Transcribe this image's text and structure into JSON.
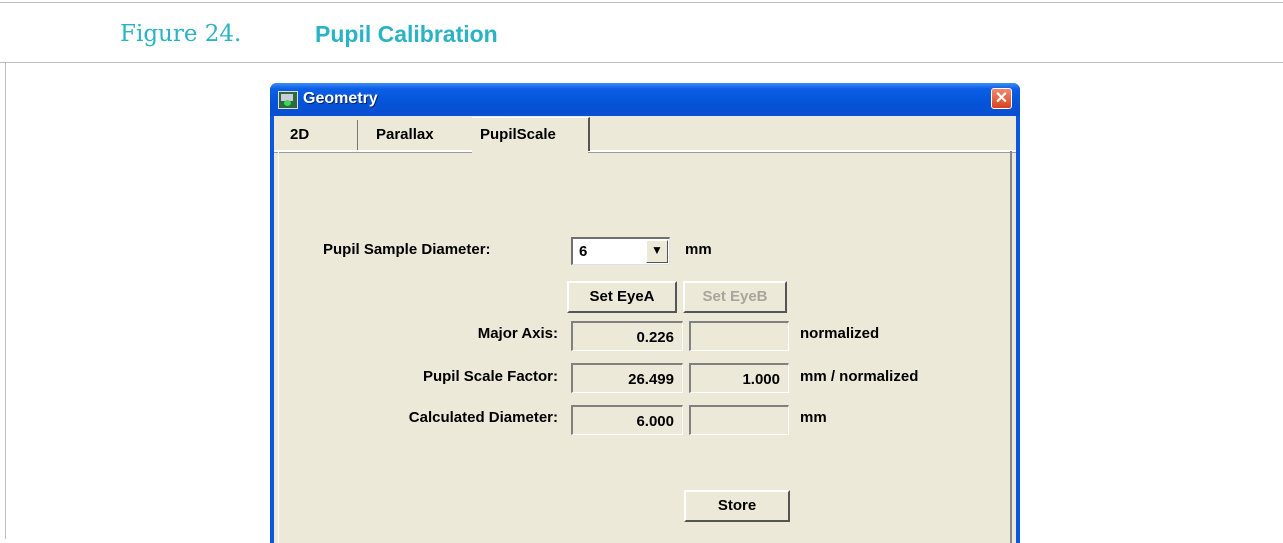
{
  "figure": {
    "number": "Figure 24.",
    "title": "Pupil Calibration"
  },
  "window": {
    "title": "Geometry",
    "icon": "app-icon",
    "close_icon": "close-icon",
    "close_glyph": "✕"
  },
  "tabs": [
    {
      "label": "2D",
      "selected": false
    },
    {
      "label": "Parallax",
      "selected": false
    },
    {
      "label": "PupilScale",
      "selected": true
    }
  ],
  "form": {
    "sample_diameter": {
      "label": "Pupil Sample Diameter:",
      "value": "6",
      "unit": "mm",
      "dropdown_arrow": "▼"
    },
    "buttons": {
      "set_eye_a": "Set EyeA",
      "set_eye_b": "Set EyeB",
      "store": "Store"
    },
    "rows": [
      {
        "label": "Major Axis:",
        "eye_a": "0.226",
        "eye_b": "",
        "unit": "normalized"
      },
      {
        "label": "Pupil Scale Factor:",
        "eye_a": "26.499",
        "eye_b": "1.000",
        "unit": "mm / normalized"
      },
      {
        "label": "Calculated Diameter:",
        "eye_a": "6.000",
        "eye_b": "",
        "unit": "mm"
      }
    ]
  },
  "colors": {
    "caption": "#2ab3c4",
    "titlebar": "#0553d8",
    "dialog_bg": "#ece9d8"
  }
}
